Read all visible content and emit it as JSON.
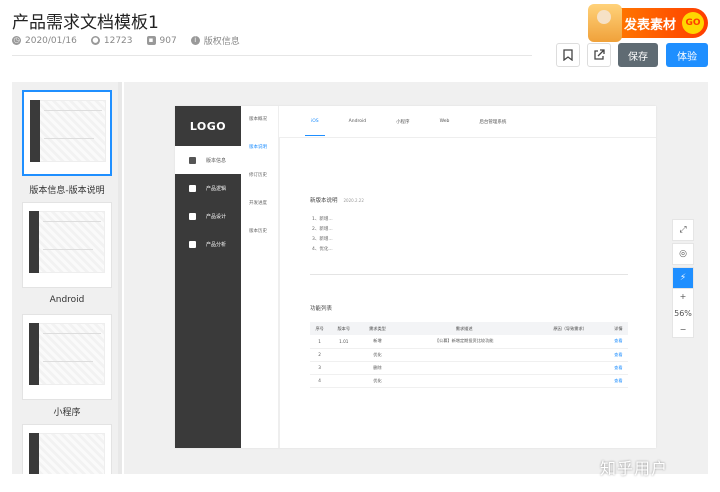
{
  "header": {
    "title": "产品需求文档模板1",
    "date": "2020/01/16",
    "views": "12723",
    "count": "907",
    "license": "版权信息"
  },
  "promo": {
    "text": "发表素材",
    "badge": "GO"
  },
  "actions": {
    "save": "保存",
    "try": "体验"
  },
  "thumbnails": [
    {
      "label": "版本信息-版本说明"
    },
    {
      "label": "Android"
    },
    {
      "label": "小程序"
    },
    {
      "label": ""
    }
  ],
  "page": {
    "logo": "LOGO",
    "nav": [
      "版本信息",
      "产品逻辑",
      "产品设计",
      "产品分析"
    ],
    "subnav": [
      "版本概况",
      "版本说明",
      "修订历史",
      "开发进度",
      "版本历史"
    ],
    "tabs": [
      "iOS",
      "Android",
      "小程序",
      "Web",
      "后台管理系统"
    ],
    "section1_title": "新版本说明",
    "section1_date": "2020.2.22",
    "list": [
      "1、新增...",
      "2、新增...",
      "3、新增...",
      "4、优化..."
    ],
    "section2_title": "功能列表",
    "table_headers": [
      "序号",
      "版本号",
      "需求类型",
      "需求描述",
      "原因（导致需求）",
      "详情"
    ],
    "table_rows": [
      [
        "1",
        "1.01",
        "新增",
        "【公募】新增定期投资比较功能",
        "",
        "查看"
      ],
      [
        "2",
        "",
        "优化",
        "",
        "",
        "查看"
      ],
      [
        "3",
        "",
        "删除",
        "",
        "",
        "查看"
      ],
      [
        "4",
        "",
        "优化",
        "",
        "",
        "查看"
      ]
    ]
  },
  "zoom": {
    "plus": "+",
    "level": "56%",
    "minus": "−"
  },
  "watermark": "知乎用户",
  "colors": {
    "accent": "#1f8fff",
    "sidebar": "#3a3a3a",
    "save": "#5f6b73",
    "promo": "#ff5a00"
  }
}
